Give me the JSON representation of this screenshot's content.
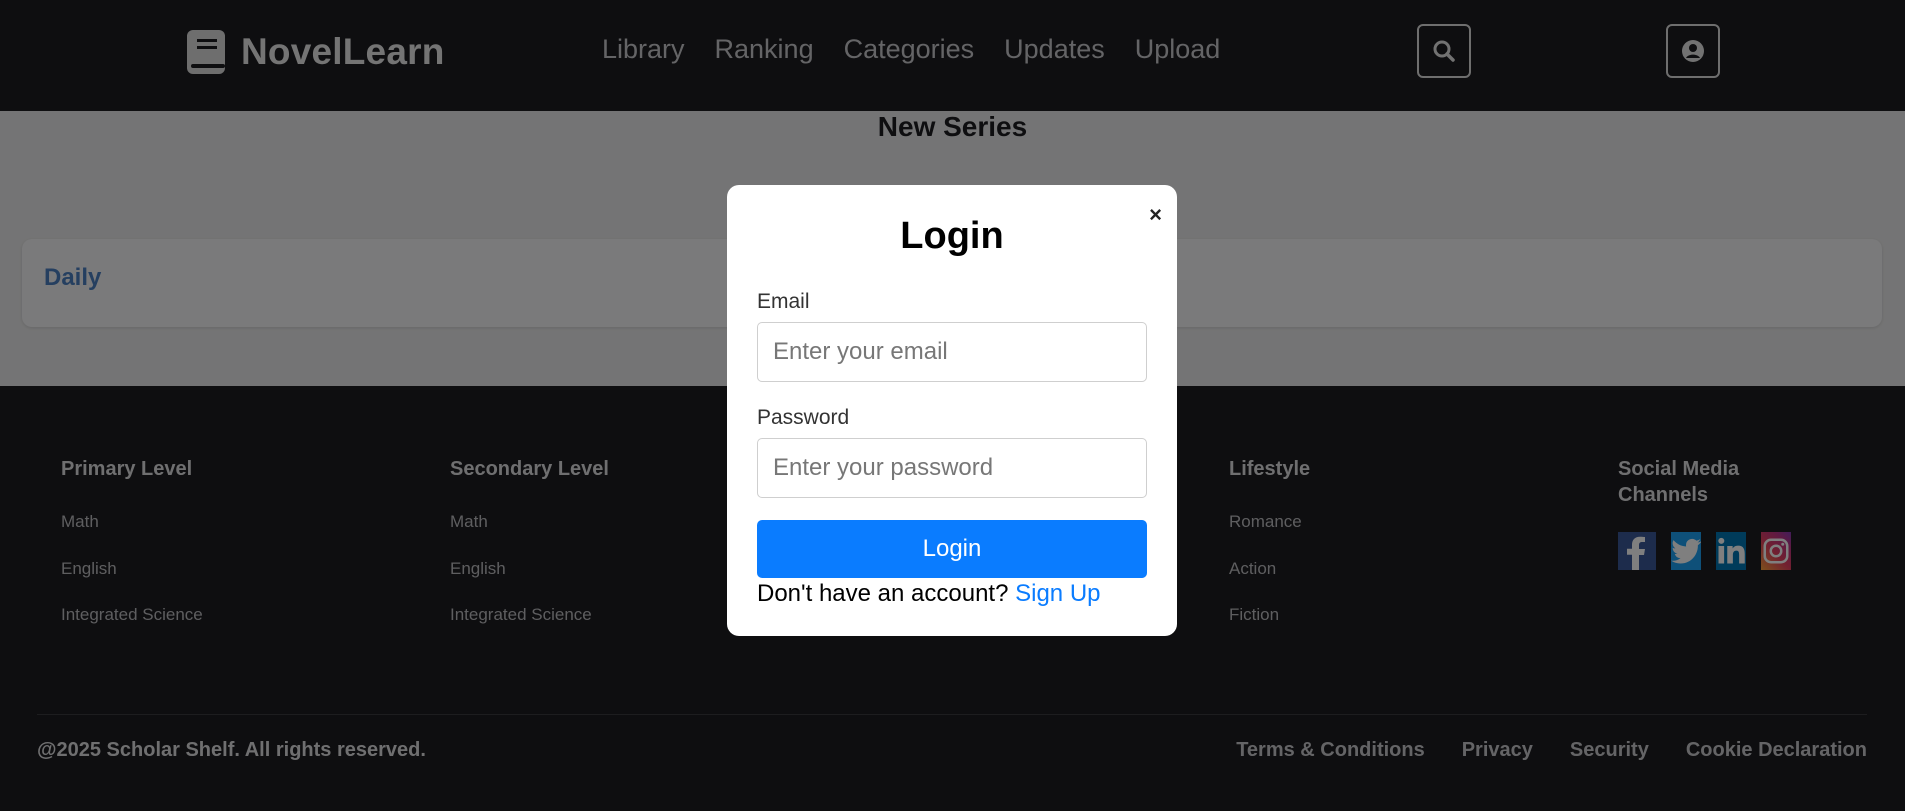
{
  "header": {
    "brand": "NovelLearn",
    "logo_icon": "book-icon",
    "nav": [
      "Library",
      "Ranking",
      "Categories",
      "Updates",
      "Upload"
    ],
    "search_icon": "search-icon",
    "user_icon": "user-icon"
  },
  "main": {
    "title": "New Series",
    "daily_label": "Daily"
  },
  "footer": {
    "columns": [
      {
        "title": "Primary Level",
        "links": [
          "Math",
          "English",
          "Integrated Science"
        ]
      },
      {
        "title": "Secondary Level",
        "links": [
          "Math",
          "English",
          "Integrated Science"
        ]
      },
      {
        "title": "Lifestyle",
        "links": [
          "Romance",
          "Action",
          "Fiction"
        ]
      }
    ],
    "social": {
      "title": "Social Media Channels",
      "icons": [
        "facebook-icon",
        "twitter-icon",
        "linkedin-icon",
        "instagram-icon"
      ]
    },
    "copyright": "@2025 Scholar Shelf. All rights reserved.",
    "legal": [
      "Terms & Conditions",
      "Privacy",
      "Security",
      "Cookie Declaration"
    ]
  },
  "modal": {
    "title": "Login",
    "close": "×",
    "email_label": "Email",
    "email_placeholder": "Enter your email",
    "password_label": "Password",
    "password_placeholder": "Enter your password",
    "submit": "Login",
    "signup_prompt": "Don't have an account?",
    "signup_link": "Sign Up"
  },
  "colors": {
    "header_bg": "#1d1d21",
    "primary_button": "#0a7cff",
    "daily_accent": "#4a7fc0",
    "facebook": "#3b5998",
    "twitter": "#1da1f2",
    "linkedin": "#0077b5"
  }
}
